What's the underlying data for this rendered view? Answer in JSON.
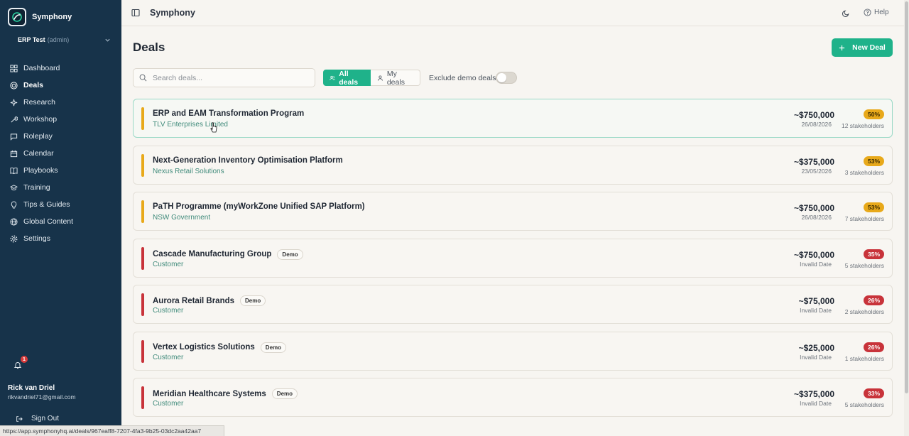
{
  "sidebar": {
    "brand": "Symphony",
    "workspace": {
      "name": "ERP Test",
      "role": "(admin)"
    },
    "items": [
      {
        "label": "Dashboard",
        "icon": "grid-icon"
      },
      {
        "label": "Deals",
        "icon": "target-icon",
        "active": true
      },
      {
        "label": "Research",
        "icon": "sparkles-icon"
      },
      {
        "label": "Workshop",
        "icon": "wrench-icon"
      },
      {
        "label": "Roleplay",
        "icon": "chat-icon"
      },
      {
        "label": "Calendar",
        "icon": "calendar-icon"
      },
      {
        "label": "Playbooks",
        "icon": "book-icon"
      },
      {
        "label": "Training",
        "icon": "graduation-cap-icon"
      },
      {
        "label": "Tips & Guides",
        "icon": "lightbulb-icon"
      },
      {
        "label": "Global Content",
        "icon": "globe-icon"
      },
      {
        "label": "Settings",
        "icon": "gear-icon"
      }
    ],
    "notification_count": "1",
    "user": {
      "name": "Rick van Driel",
      "email": "rikvandriel71@gmail.com"
    },
    "sign_out": "Sign Out"
  },
  "topbar": {
    "title": "Symphony",
    "help": "Help"
  },
  "page": {
    "title": "Deals",
    "new_deal": "New Deal"
  },
  "filters": {
    "search_placeholder": "Search deals...",
    "all_deals": "All deals",
    "my_deals": "My deals",
    "exclude_demo": "Exclude demo deals",
    "exclude_demo_on": false
  },
  "colors": {
    "accent": "#1fb28a",
    "sidebar": "#17334a",
    "amber": "#e8a91a",
    "red": "#c8333a"
  },
  "deals": [
    {
      "name": "ERP and EAM Transformation Program",
      "company": "TLV Enterprises Limited",
      "amount": "~$750,000",
      "date": "26/08/2026",
      "probability": "50%",
      "stakeholders": "12 stakeholders",
      "status": "amber",
      "demo": false
    },
    {
      "name": "Next-Generation Inventory Optimisation Platform",
      "company": "Nexus Retail Solutions",
      "amount": "~$375,000",
      "date": "23/05/2026",
      "probability": "53%",
      "stakeholders": "3 stakeholders",
      "status": "amber",
      "demo": false
    },
    {
      "name": "PaTH Programme (myWorkZone Unified SAP Platform)",
      "company": "NSW Government",
      "amount": "~$750,000",
      "date": "26/08/2026",
      "probability": "53%",
      "stakeholders": "7 stakeholders",
      "status": "amber",
      "demo": false
    },
    {
      "name": "Cascade Manufacturing Group",
      "company": "Customer",
      "amount": "~$750,000",
      "date": "Invalid Date",
      "probability": "35%",
      "stakeholders": "5 stakeholders",
      "status": "red",
      "demo": true
    },
    {
      "name": "Aurora Retail Brands",
      "company": "Customer",
      "amount": "~$75,000",
      "date": "Invalid Date",
      "probability": "26%",
      "stakeholders": "2 stakeholders",
      "status": "red",
      "demo": true
    },
    {
      "name": "Vertex Logistics Solutions",
      "company": "Customer",
      "amount": "~$25,000",
      "date": "Invalid Date",
      "probability": "26%",
      "stakeholders": "1 stakeholders",
      "status": "red",
      "demo": true
    },
    {
      "name": "Meridian Healthcare Systems",
      "company": "Customer",
      "amount": "~$375,000",
      "date": "Invalid Date",
      "probability": "33%",
      "stakeholders": "5 stakeholders",
      "status": "red",
      "demo": true
    }
  ],
  "demo_label": "Demo",
  "status_url": "https://app.symphonyhq.ai/deals/967eaff8-7207-4fa3-9b25-03dc2aa42aa7"
}
